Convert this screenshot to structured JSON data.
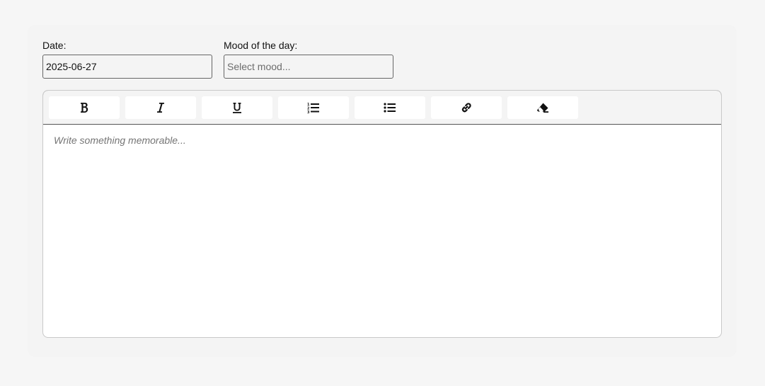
{
  "form": {
    "date": {
      "label": "Date:",
      "value": "2025-06-27"
    },
    "mood": {
      "label": "Mood of the day:",
      "value": "",
      "placeholder": "Select mood..."
    }
  },
  "editor": {
    "toolbar": {
      "buttons": [
        {
          "icon": "bold-icon"
        },
        {
          "icon": "italic-icon"
        },
        {
          "icon": "underline-icon"
        },
        {
          "icon": "ordered-list-icon"
        },
        {
          "icon": "unordered-list-icon"
        },
        {
          "icon": "link-icon"
        },
        {
          "icon": "eraser-icon"
        }
      ]
    },
    "placeholder": "Write something memorable...",
    "content": ""
  },
  "colors": {
    "page_background": "#f6f6f6",
    "card_background": "#f4f4f4",
    "icon_color": "#111111",
    "placeholder_color": "#757575"
  }
}
